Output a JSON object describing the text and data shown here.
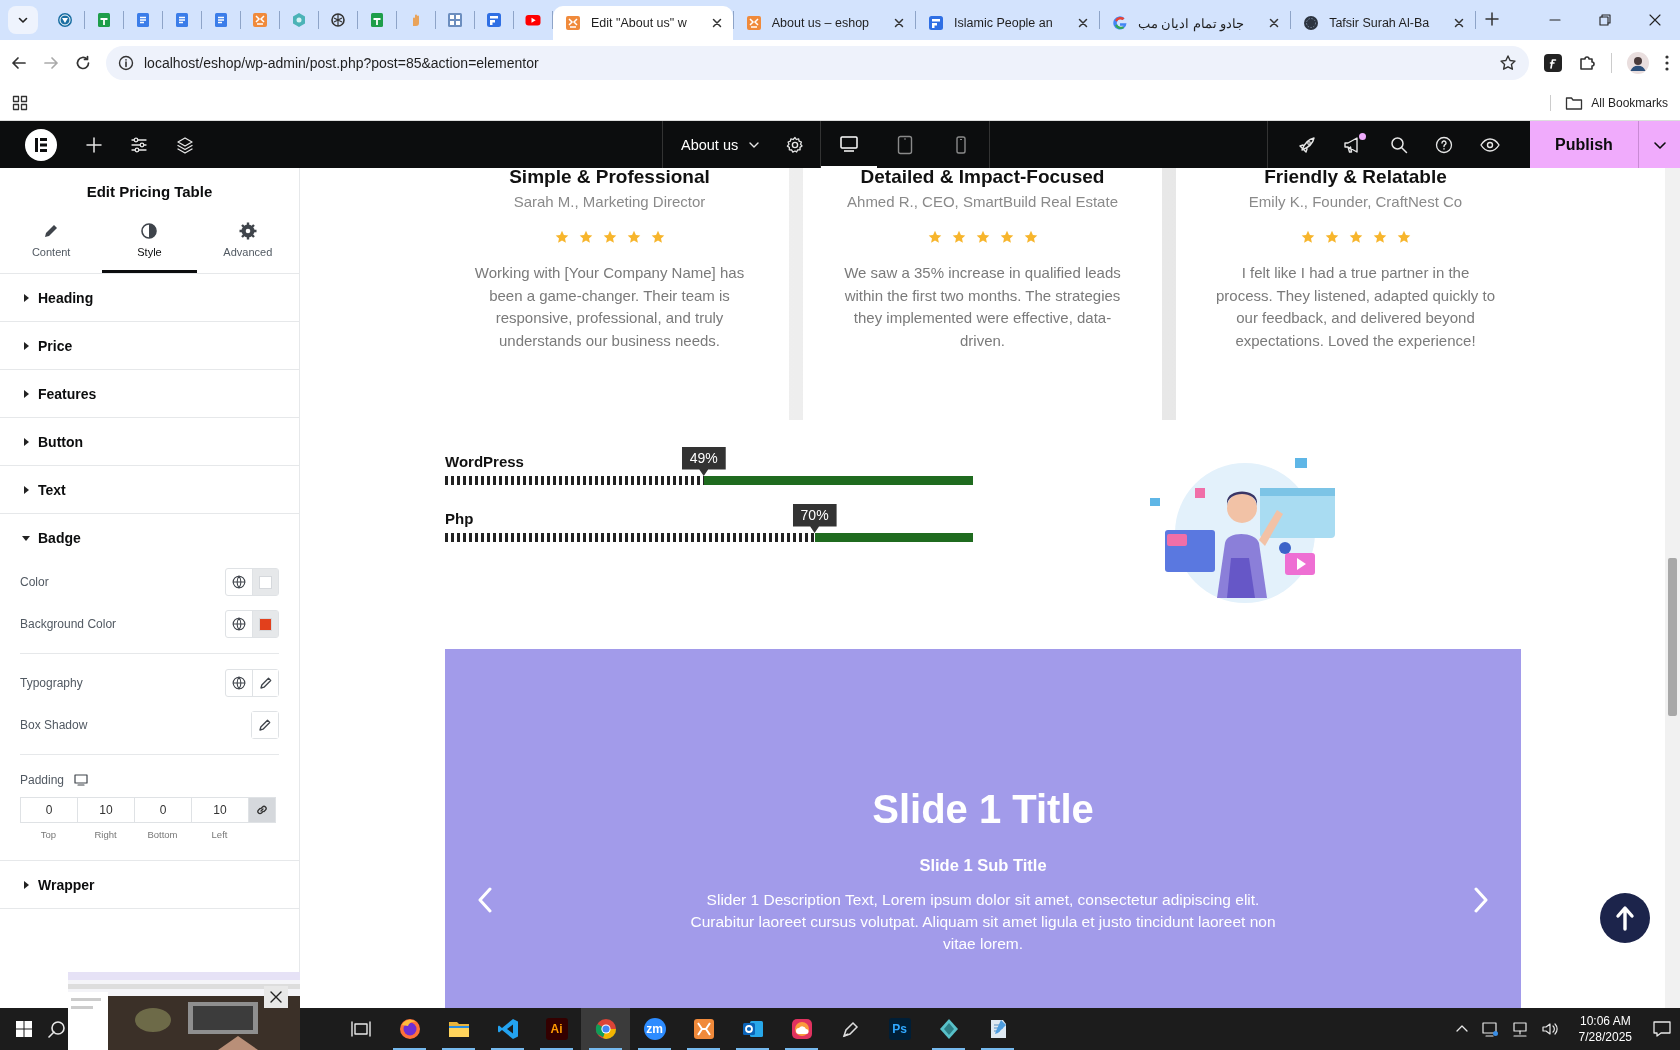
{
  "browser": {
    "pinned_tabs": [
      {
        "kind": "shield"
      },
      {
        "kind": "sheets"
      },
      {
        "kind": "docs"
      },
      {
        "kind": "docs"
      },
      {
        "kind": "docs"
      },
      {
        "kind": "xampp"
      },
      {
        "kind": "hexagon"
      },
      {
        "kind": "knot"
      },
      {
        "kind": "sheets"
      },
      {
        "kind": "hand"
      },
      {
        "kind": "tiles"
      },
      {
        "kind": "forms"
      },
      {
        "kind": "video"
      }
    ],
    "tabs": [
      {
        "kind": "xampp",
        "label": "Edit \"About us\" w",
        "selected": true
      },
      {
        "kind": "xampp",
        "label": "About us – eshop",
        "selected": false
      },
      {
        "kind": "forms",
        "label": "Islamic People an",
        "selected": false
      },
      {
        "kind": "google",
        "label": "جادو تمام ادیان مب",
        "selected": false
      },
      {
        "kind": "disc",
        "label": "Tafsir Surah Al-Ba",
        "selected": false
      }
    ],
    "address": "localhost/eshop/wp-admin/post.php?post=85&action=elementor",
    "bookmarks_folder": "All Bookmarks"
  },
  "editor_bar": {
    "page": "About us",
    "devices": [
      {
        "kind": "desktop",
        "selected": true
      },
      {
        "kind": "tablet",
        "selected": false
      },
      {
        "kind": "mobile",
        "selected": false
      }
    ],
    "notification": true,
    "publish": "Publish"
  },
  "panel": {
    "title": "Edit Pricing Table",
    "tabs": [
      {
        "kind": "content",
        "label": "Content",
        "selected": false
      },
      {
        "kind": "style",
        "label": "Style",
        "selected": true
      },
      {
        "kind": "advanced",
        "label": "Advanced",
        "selected": false
      }
    ],
    "sections": [
      {
        "label": "Heading",
        "expanded": false
      },
      {
        "label": "Price",
        "expanded": false
      },
      {
        "label": "Features",
        "expanded": false
      },
      {
        "label": "Button",
        "expanded": false
      },
      {
        "label": "Text",
        "expanded": false
      },
      {
        "label": "Badge",
        "expanded": true,
        "controls": [
          {
            "kind": "color",
            "label": "Color",
            "global": true,
            "color": "#ffffff"
          },
          {
            "kind": "color",
            "label": "Background Color",
            "global": true,
            "color": "#e2401c"
          },
          {
            "kind": "edit",
            "label": "Typography",
            "global": true
          },
          {
            "kind": "edit",
            "label": "Box Shadow",
            "global": false
          },
          {
            "kind": "padding",
            "label": "Padding",
            "linked": true,
            "values": [
              {
                "value": "0",
                "caption": "Top"
              },
              {
                "value": "10",
                "caption": "Right"
              },
              {
                "value": "0",
                "caption": "Bottom"
              },
              {
                "value": "10",
                "caption": "Left"
              }
            ]
          }
        ]
      },
      {
        "label": "Wrapper",
        "expanded": false
      }
    ]
  },
  "canvas": {
    "testimonials": [
      {
        "title": "Simple & Professional",
        "author": "Sarah M., Marketing Director",
        "stars": 5,
        "text": "Working with [Your Company Name] has been a game-changer. Their team is responsive, professional, and truly understands our business needs."
      },
      {
        "title": "Detailed & Impact-Focused",
        "author": "Ahmed R., CEO, SmartBuild Real Estate",
        "stars": 5,
        "text": "We saw a 35% increase in qualified leads within the first two months. The strategies they implemented were effective, data-driven."
      },
      {
        "title": "Friendly & Relatable",
        "author": "Emily K., Founder, CraftNest Co",
        "stars": 5,
        "text": "I felt like I had a true partner in the process. They listened, adapted quickly to our feedback, and delivered beyond expectations. Loved the experience!"
      }
    ],
    "skills": [
      {
        "name": "WordPress",
        "level": 0.49,
        "reading": "49%"
      },
      {
        "name": "Php",
        "level": 0.7,
        "reading": "70%"
      }
    ],
    "slider": {
      "title": "Slide 1 Title",
      "subtitle": "Slide 1 Sub Title",
      "description": "Slider 1 Description Text, Lorem ipsum dolor sit amet, consectetur adipiscing elit. Curabitur laoreet cursus volutpat. Aliquam sit amet ligula et justo tincidunt laoreet non vitae lorem."
    }
  },
  "taskbar": {
    "apps": [
      {
        "kind": "firefox",
        "running": true,
        "selected": false
      },
      {
        "kind": "folder",
        "running": true,
        "selected": false
      },
      {
        "kind": "code",
        "running": true,
        "selected": false
      },
      {
        "kind": "lettered",
        "label": "Ai",
        "running": true,
        "selected": false
      },
      {
        "kind": "chrome",
        "running": true,
        "selected": true
      },
      {
        "kind": "lettered",
        "label": "zm",
        "running": true,
        "selected": false
      },
      {
        "kind": "xampp",
        "running": true,
        "selected": false
      },
      {
        "kind": "mail",
        "running": true,
        "selected": false
      },
      {
        "kind": "cloud",
        "running": true,
        "selected": false
      },
      {
        "kind": "pen",
        "running": false,
        "selected": false
      },
      {
        "kind": "lettered",
        "label": "Ps",
        "running": false,
        "selected": false
      },
      {
        "kind": "gem",
        "running": true,
        "selected": false
      },
      {
        "kind": "notepad",
        "running": true,
        "selected": false
      }
    ],
    "time": "10:06 AM",
    "date": "7/28/2025"
  }
}
